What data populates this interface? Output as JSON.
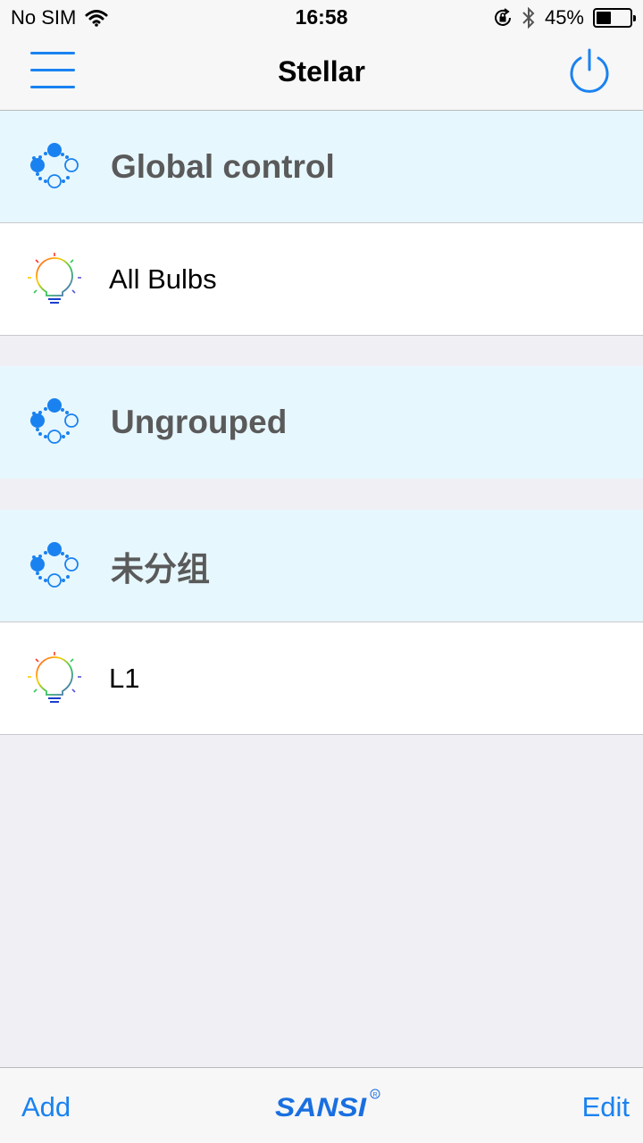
{
  "status_bar": {
    "carrier": "No SIM",
    "time": "16:58",
    "battery": "45%",
    "battery_level": 0.45,
    "icons": [
      "wifi-icon",
      "rotation-lock-icon",
      "bluetooth-icon",
      "battery-icon"
    ]
  },
  "nav": {
    "title": "Stellar",
    "left_icon": "hamburger-menu-icon",
    "right_icon": "power-icon"
  },
  "list": {
    "global_control": "Global control",
    "all_bulbs": "All Bulbs",
    "ungrouped": "Ungrouped",
    "group_unassigned": "未分组",
    "bulb_l1": "L1"
  },
  "toolbar": {
    "add_label": "Add",
    "edit_label": "Edit",
    "logo_text": "SANSI"
  },
  "colors": {
    "accent": "#1a82f0",
    "group_row_bg": "#e7f7fe",
    "background": "#efeff4"
  }
}
